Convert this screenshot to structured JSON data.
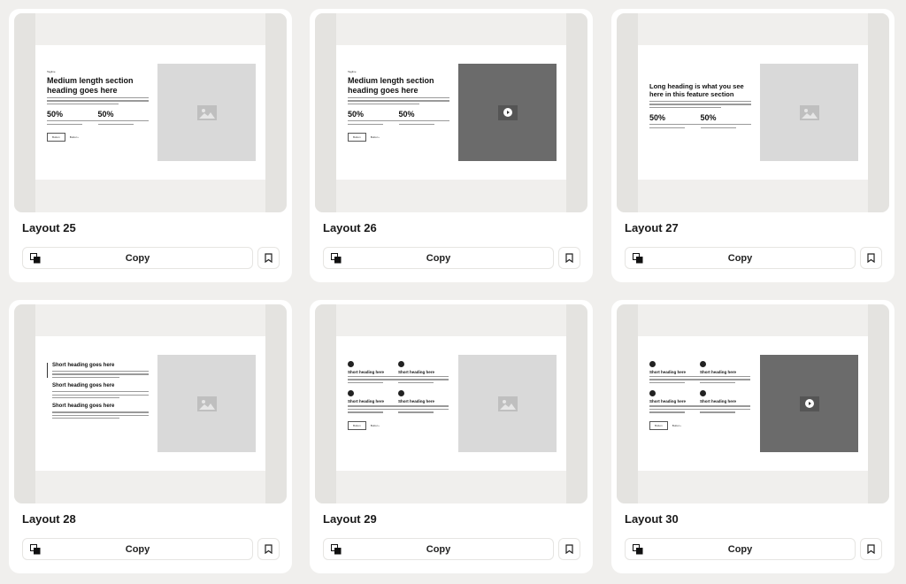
{
  "cards": [
    {
      "title": "Layout 25",
      "copy_label": "Copy",
      "preview": {
        "type": "heading-stats",
        "tagline": "Tagline",
        "heading": "Medium length section heading goes here",
        "stats": [
          {
            "value": "50%"
          },
          {
            "value": "50%"
          }
        ],
        "button": "Button",
        "link": "Button ›",
        "media": "image-placeholder"
      }
    },
    {
      "title": "Layout 26",
      "copy_label": "Copy",
      "preview": {
        "type": "heading-stats",
        "tagline": "Tagline",
        "heading": "Medium length section heading goes here",
        "stats": [
          {
            "value": "50%"
          },
          {
            "value": "50%"
          }
        ],
        "button": "Button",
        "link": "Button ›",
        "media": "video-placeholder"
      }
    },
    {
      "title": "Layout 27",
      "copy_label": "Copy",
      "preview": {
        "type": "heading-stats-long",
        "heading": "Long heading is what you see here in this feature section",
        "stats": [
          {
            "value": "50%"
          },
          {
            "value": "50%"
          }
        ],
        "media": "image-placeholder"
      }
    },
    {
      "title": "Layout 28",
      "copy_label": "Copy",
      "preview": {
        "type": "feature-list",
        "items": [
          "Short heading goes here",
          "Short heading goes here",
          "Short heading goes here"
        ],
        "media": "image-placeholder"
      }
    },
    {
      "title": "Layout 29",
      "copy_label": "Copy",
      "preview": {
        "type": "feature-grid",
        "items": [
          "Short heading here",
          "Short heading here",
          "Short heading here",
          "Short heading here"
        ],
        "button": "Button",
        "link": "Button ›",
        "media": "image-placeholder"
      }
    },
    {
      "title": "Layout 30",
      "copy_label": "Copy",
      "preview": {
        "type": "feature-grid",
        "items": [
          "Short heading here",
          "Short heading here",
          "Short heading here",
          "Short heading here"
        ],
        "button": "Button",
        "link": "Button ›",
        "media": "video-placeholder"
      }
    }
  ],
  "icons": {
    "copy": "copy-icon",
    "bookmark": "bookmark-icon",
    "image": "image-icon",
    "play": "play-icon",
    "cube": "cube-icon"
  }
}
